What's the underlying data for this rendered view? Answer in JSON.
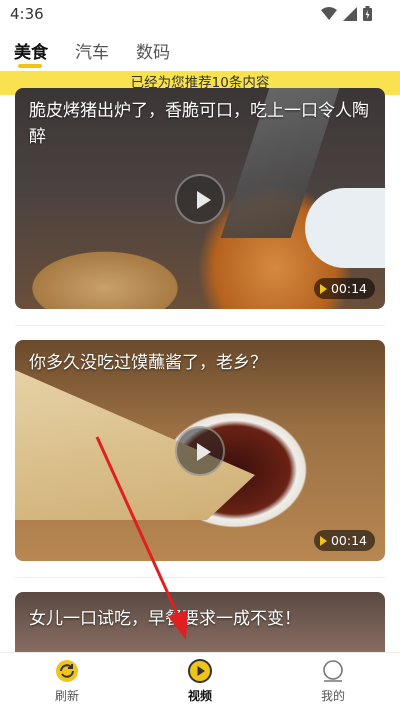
{
  "status_bar": {
    "time": "4:36",
    "icons": [
      "wifi-icon",
      "signal-icon",
      "battery-icon"
    ]
  },
  "tabs": [
    {
      "label": "美食",
      "active": true
    },
    {
      "label": "汽车",
      "active": false
    },
    {
      "label": "数码",
      "active": false
    }
  ],
  "banner": {
    "text": "已经为您推荐10条内容"
  },
  "feed": [
    {
      "title": "脆皮烤猪出炉了，香脆可口，吃上一口令人陶醉",
      "duration": "00:14"
    },
    {
      "title": "你多久没吃过馍蘸酱了，老乡？",
      "duration": "00:14"
    },
    {
      "title": "女儿一口试吃，早餐要求一成不变！",
      "duration": ""
    }
  ],
  "bottom_nav": [
    {
      "label": "刷新",
      "icon": "refresh-icon",
      "active": false
    },
    {
      "label": "视频",
      "icon": "video-play-icon",
      "active": true
    },
    {
      "label": "我的",
      "icon": "profile-icon",
      "active": false
    }
  ],
  "colors": {
    "accent": "#f0c419",
    "banner": "#f8e24f",
    "annotation_arrow": "#e02020"
  }
}
